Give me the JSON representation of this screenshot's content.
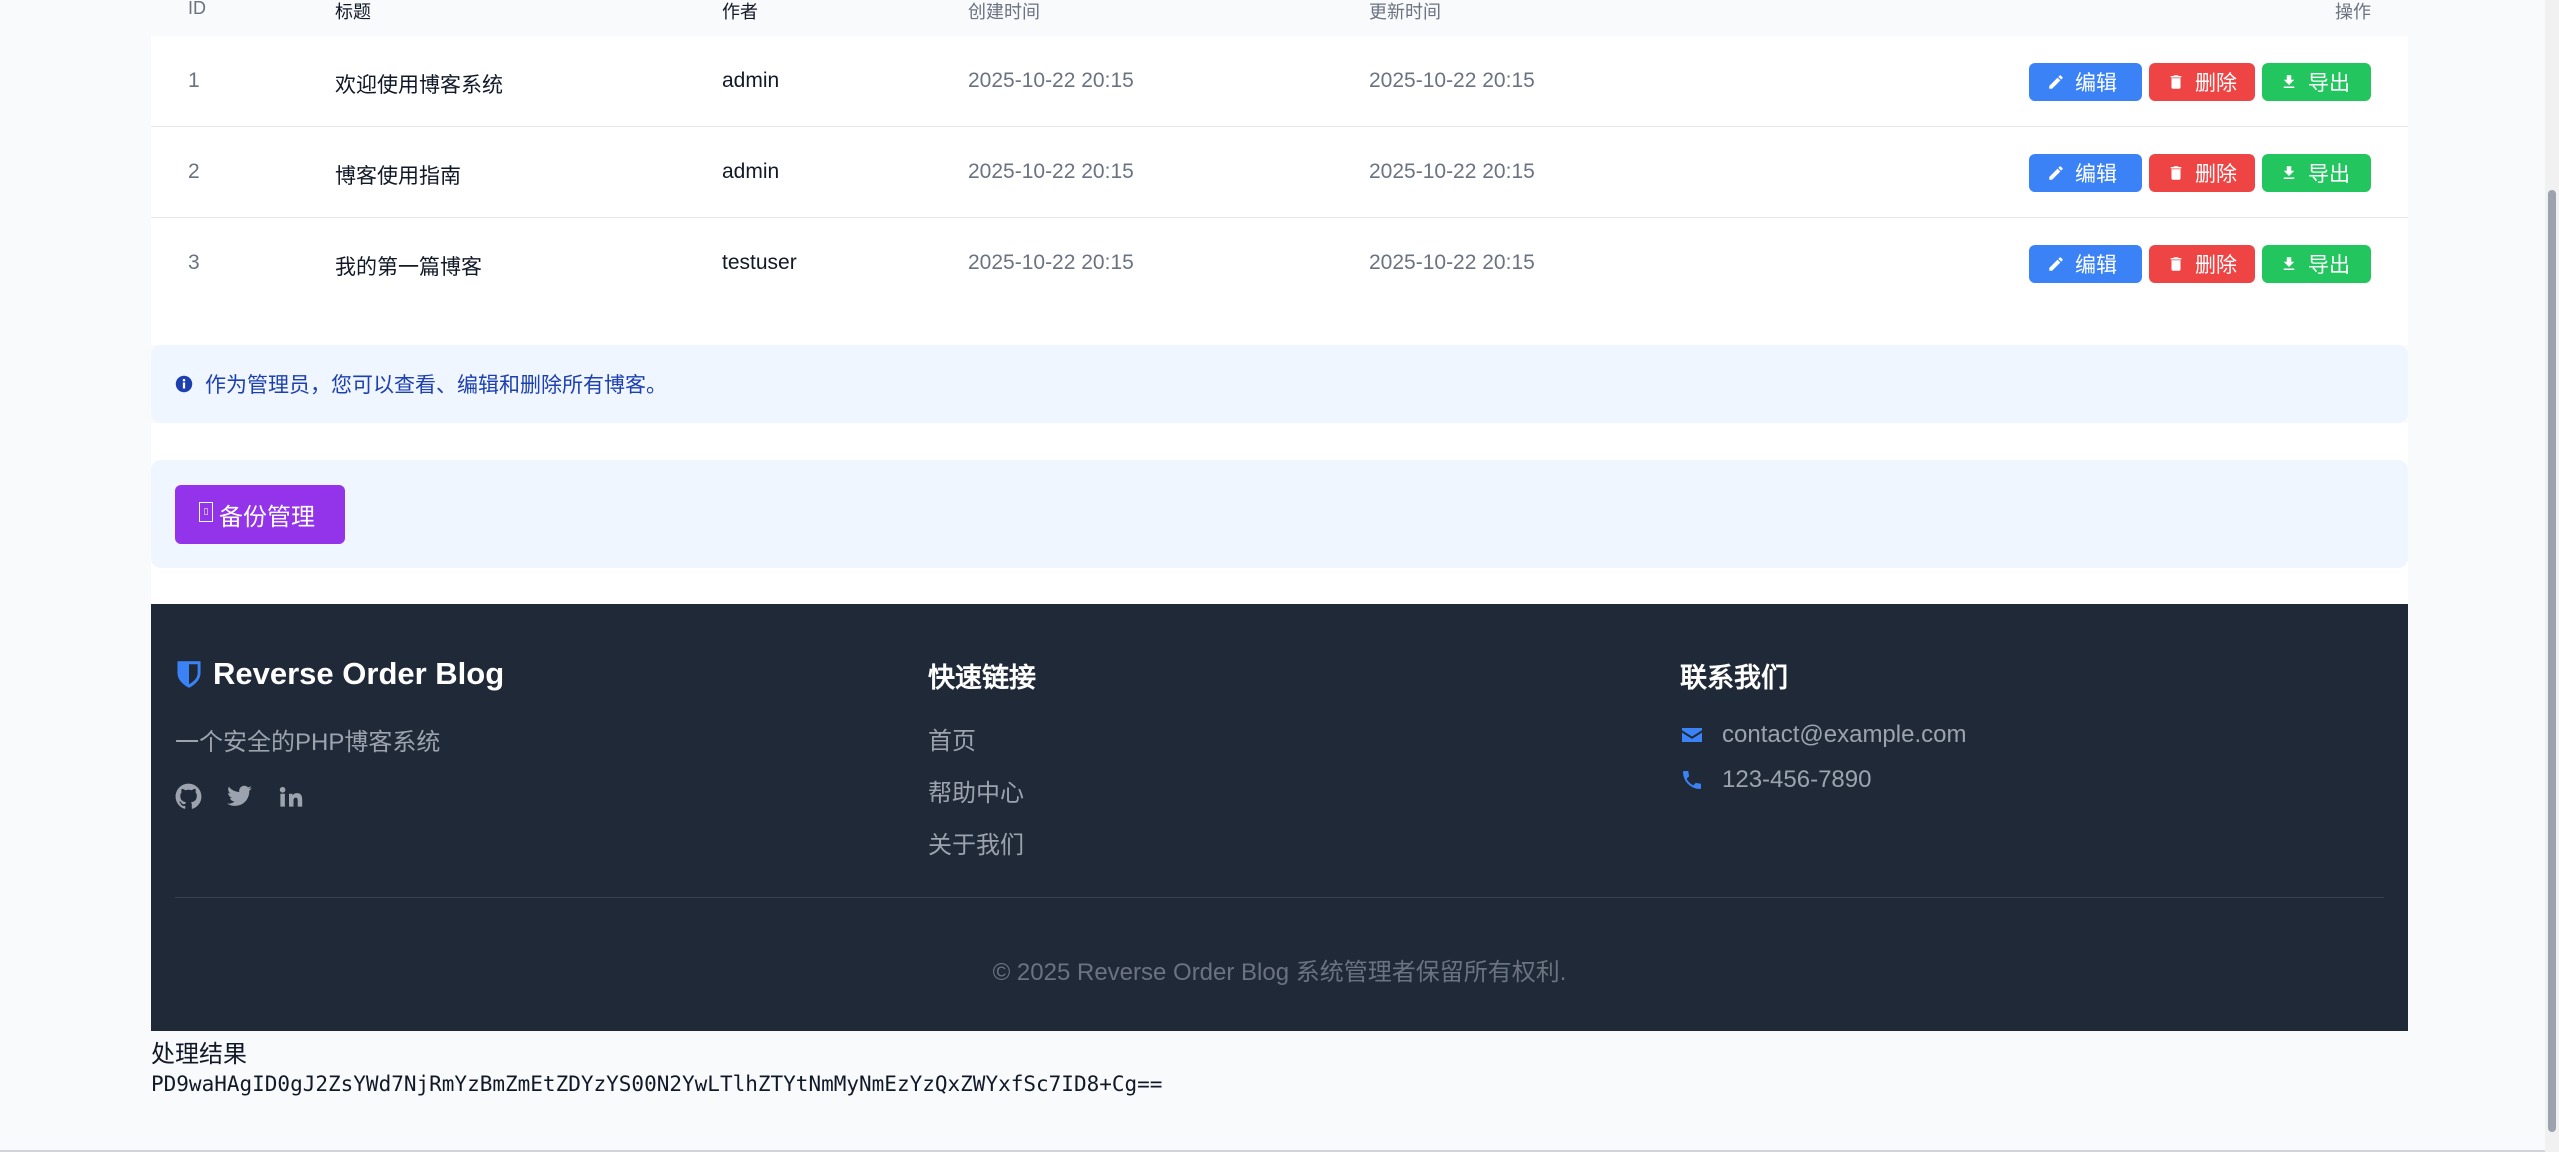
{
  "table": {
    "headers": {
      "id": "ID",
      "title": "标题",
      "author": "作者",
      "created": "创建时间",
      "updated": "更新时间",
      "actions": "操作"
    },
    "rows": [
      {
        "id": "1",
        "title": "欢迎使用博客系统",
        "author": "admin",
        "created": "2025-10-22 20:15",
        "updated": "2025-10-22 20:15"
      },
      {
        "id": "2",
        "title": "博客使用指南",
        "author": "admin",
        "created": "2025-10-22 20:15",
        "updated": "2025-10-22 20:15"
      },
      {
        "id": "3",
        "title": "我的第一篇博客",
        "author": "testuser",
        "created": "2025-10-22 20:15",
        "updated": "2025-10-22 20:15"
      }
    ],
    "buttons": {
      "edit": "编辑",
      "delete": "删除",
      "export": "导出"
    }
  },
  "info": {
    "text": "作为管理员，您可以查看、编辑和删除所有博客。",
    "icon": "info-circle-icon"
  },
  "backup": {
    "label": "备份管理",
    "icon": "broken-glyph-icon"
  },
  "footer": {
    "brand": "Reverse Order Blog",
    "tagline": "一个安全的PHP博客系统",
    "social_icons": [
      "github-icon",
      "twitter-icon",
      "linkedin-icon"
    ],
    "quick_links_title": "快速链接",
    "quick_links": [
      "首页",
      "帮助中心",
      "关于我们"
    ],
    "contact_title": "联系我们",
    "email": "contact@example.com",
    "phone": "123-456-7890",
    "copyright": "© 2025 Reverse Order Blog 系统管理者保留所有权利."
  },
  "result": {
    "title": "处理结果",
    "data": "PD9waHAgID0gJ2ZsYWd7NjRmYzBmZmEtZDYzYS00N2YwLTlhZTYtNmMyNmEzYzQxZWYxfSc7ID8+Cg=="
  },
  "colors": {
    "edit": "#3b82f6",
    "delete": "#ef4444",
    "export": "#22c55e",
    "backup": "#9333ea",
    "footer_bg": "#1f2937",
    "info_bg": "#eff6ff"
  }
}
